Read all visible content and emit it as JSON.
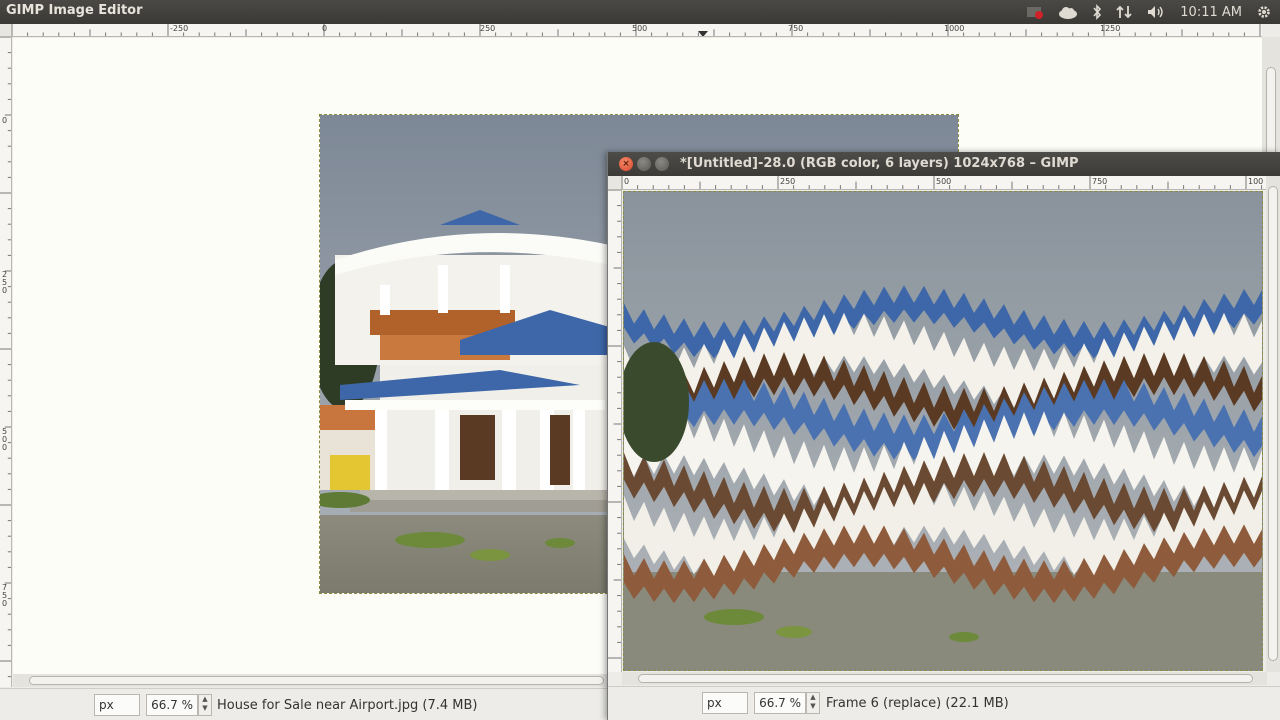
{
  "panel": {
    "app_title": "GIMP Image Editor",
    "clock": "10:11 AM",
    "icons": [
      "record-indicator-icon",
      "cloud-icon",
      "bluetooth-icon",
      "network-icon",
      "volume-icon",
      "settings-gear-icon"
    ]
  },
  "main_window": {
    "ruler_ticks": [
      "-250",
      "0",
      "250",
      "500",
      "750",
      "1000",
      "1250"
    ],
    "vruler_ticks": [
      "0",
      "2\n5\n0",
      "5\n0\n0",
      "7\n5\n0"
    ],
    "status": {
      "unit": "px",
      "zoom": "66.7 %",
      "info": "House for Sale near Airport.jpg (7.4 MB)"
    }
  },
  "second_window": {
    "title": "*[Untitled]-28.0 (RGB color, 6 layers) 1024x768 – GIMP",
    "ruler_ticks": [
      "0",
      "250",
      "500",
      "750",
      "100"
    ],
    "status": {
      "unit": "px",
      "zoom": "66.7 %",
      "info": "Frame 6 (replace) (22.1 MB)"
    }
  }
}
